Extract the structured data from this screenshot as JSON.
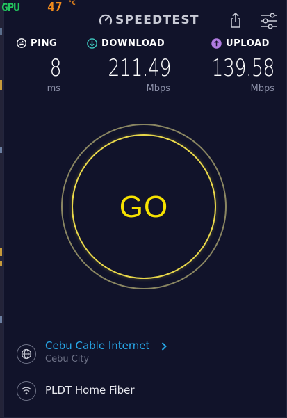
{
  "overlay": {
    "gpu_label": "GPU",
    "gpu_temp": "47",
    "gpu_unit": "°C"
  },
  "header": {
    "logo_text": "SPEEDTEST",
    "share_icon": "share-icon",
    "settings_icon": "settings-sliders-icon"
  },
  "metrics": {
    "ping": {
      "label": "PING",
      "value": "8",
      "unit": "ms",
      "icon": "ping-icon",
      "icon_color": "#ffffff"
    },
    "download": {
      "label": "DOWNLOAD",
      "value": "211.49",
      "unit": "Mbps",
      "icon": "download-arrow-icon",
      "icon_color": "#3fc9c0"
    },
    "upload": {
      "label": "UPLOAD",
      "value": "139.58",
      "unit": "Mbps",
      "icon": "upload-arrow-icon",
      "icon_color": "#b07be0"
    }
  },
  "go_button": {
    "label": "GO",
    "color": "#f6e200"
  },
  "provider": {
    "name": "Cebu Cable Internet",
    "location": "Cebu City",
    "icon": "globe-icon",
    "link_color": "#27a6e6"
  },
  "network": {
    "name": "PLDT Home Fiber",
    "icon": "wifi-icon"
  }
}
